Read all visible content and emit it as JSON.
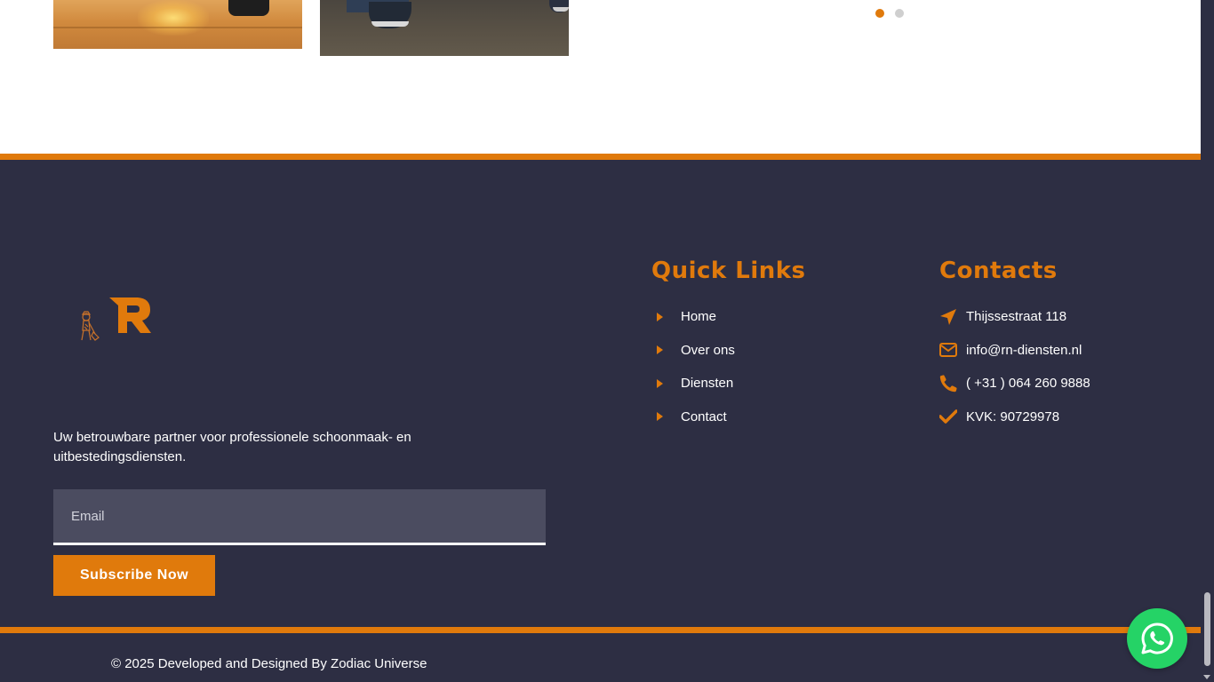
{
  "slider": {
    "dots": [
      {
        "active": true
      },
      {
        "active": false
      }
    ]
  },
  "footer": {
    "tagline": "Uw betrouwbare partner voor professionele schoonmaak- en uitbestedingsdiensten.",
    "subscribe": {
      "email_placeholder": "Email",
      "email_value": "",
      "button_label": "Subscribe Now"
    },
    "quick_links": {
      "title": "Quick Links",
      "items": [
        {
          "label": "Home"
        },
        {
          "label": "Over ons"
        },
        {
          "label": "Diensten"
        },
        {
          "label": "Contact"
        }
      ]
    },
    "contacts": {
      "title": "Contacts",
      "items": [
        {
          "icon": "location-arrow-icon",
          "text": "Thijssestraat 118"
        },
        {
          "icon": "envelope-icon",
          "text": "info@rn-diensten.nl"
        },
        {
          "icon": "phone-icon",
          "text": "( +31 ) 064 260 9888"
        },
        {
          "icon": "check-icon",
          "text": "KVK: 90729978"
        }
      ]
    },
    "copyright": "© 2025 Developed and Designed By Zodiac Universe"
  },
  "colors": {
    "accent": "#e07a0c",
    "footer_bg": "#2d2e43",
    "input_bg": "#4b4c60",
    "whatsapp": "#25d366"
  }
}
